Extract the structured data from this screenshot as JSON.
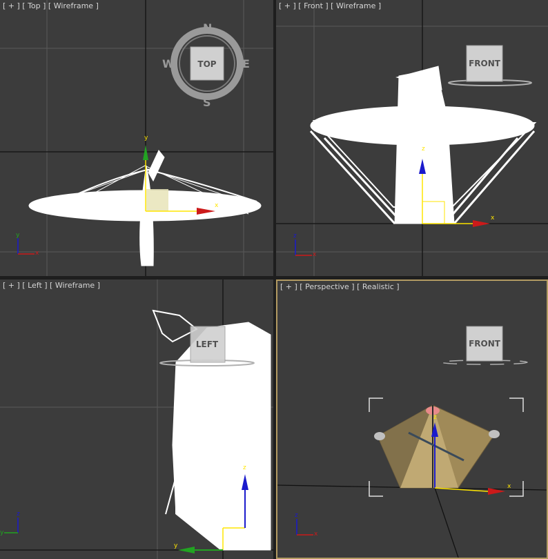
{
  "viewports": {
    "top": {
      "label": "[ + ] [ Top ] [ Wireframe ]",
      "viewcube": "TOP",
      "compass": {
        "n": "N",
        "s": "S",
        "e": "E",
        "w": "W"
      },
      "gizmo": {
        "x": "x",
        "y": "y"
      },
      "mini_axes": {
        "y": "y",
        "x": "x"
      }
    },
    "front": {
      "label": "[ + ] [ Front ] [ Wireframe ]",
      "viewcube": "FRONT",
      "gizmo": {
        "x": "x",
        "z": "z"
      },
      "mini_axes": {
        "z": "z",
        "x": "x"
      }
    },
    "left": {
      "label": "[ + ] [ Left ] [ Wireframe ]",
      "viewcube": "LEFT",
      "gizmo": {
        "y": "y",
        "z": "z"
      },
      "mini_axes": {
        "z": "z",
        "y": "y"
      }
    },
    "perspective": {
      "label": "[ + ] [ Perspective ] [ Realistic ]",
      "viewcube": "FRONT",
      "gizmo": {
        "x": "x",
        "z": "z"
      },
      "mini_axes": {
        "z": "z",
        "x": "x"
      }
    }
  },
  "colors": {
    "viewport_bg": "#3c3c3c",
    "grid_line": "#5a5a5a",
    "world_axis": "#111111",
    "wireframe": "#ffffff",
    "gizmo_x": "#cc1a1a",
    "gizmo_y": "#22a322",
    "gizmo_z": "#1a1acc",
    "active_border": "#b39b62"
  }
}
